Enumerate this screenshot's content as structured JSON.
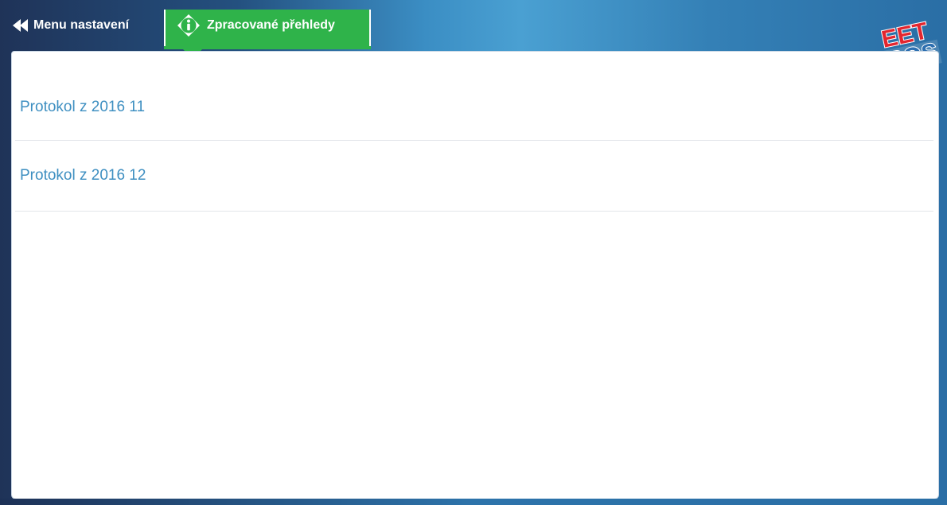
{
  "topbar": {
    "back_label": "Menu nastavení",
    "active_tab_label": "Zpracované přehledy"
  },
  "logo": {
    "line1": "EET",
    "line2": "POS"
  },
  "list": {
    "items": [
      {
        "label": "Protokol z 2016 11"
      },
      {
        "label": "Protokol z 2016 12"
      }
    ]
  },
  "colors": {
    "accent_green": "#2fb34a",
    "link_blue": "#3e8fc1",
    "logo_red": "#e3262f",
    "logo_blue": "#2d6fb0"
  },
  "icons": {
    "back": "double-left-arrow-icon",
    "tab": "info-icon"
  }
}
